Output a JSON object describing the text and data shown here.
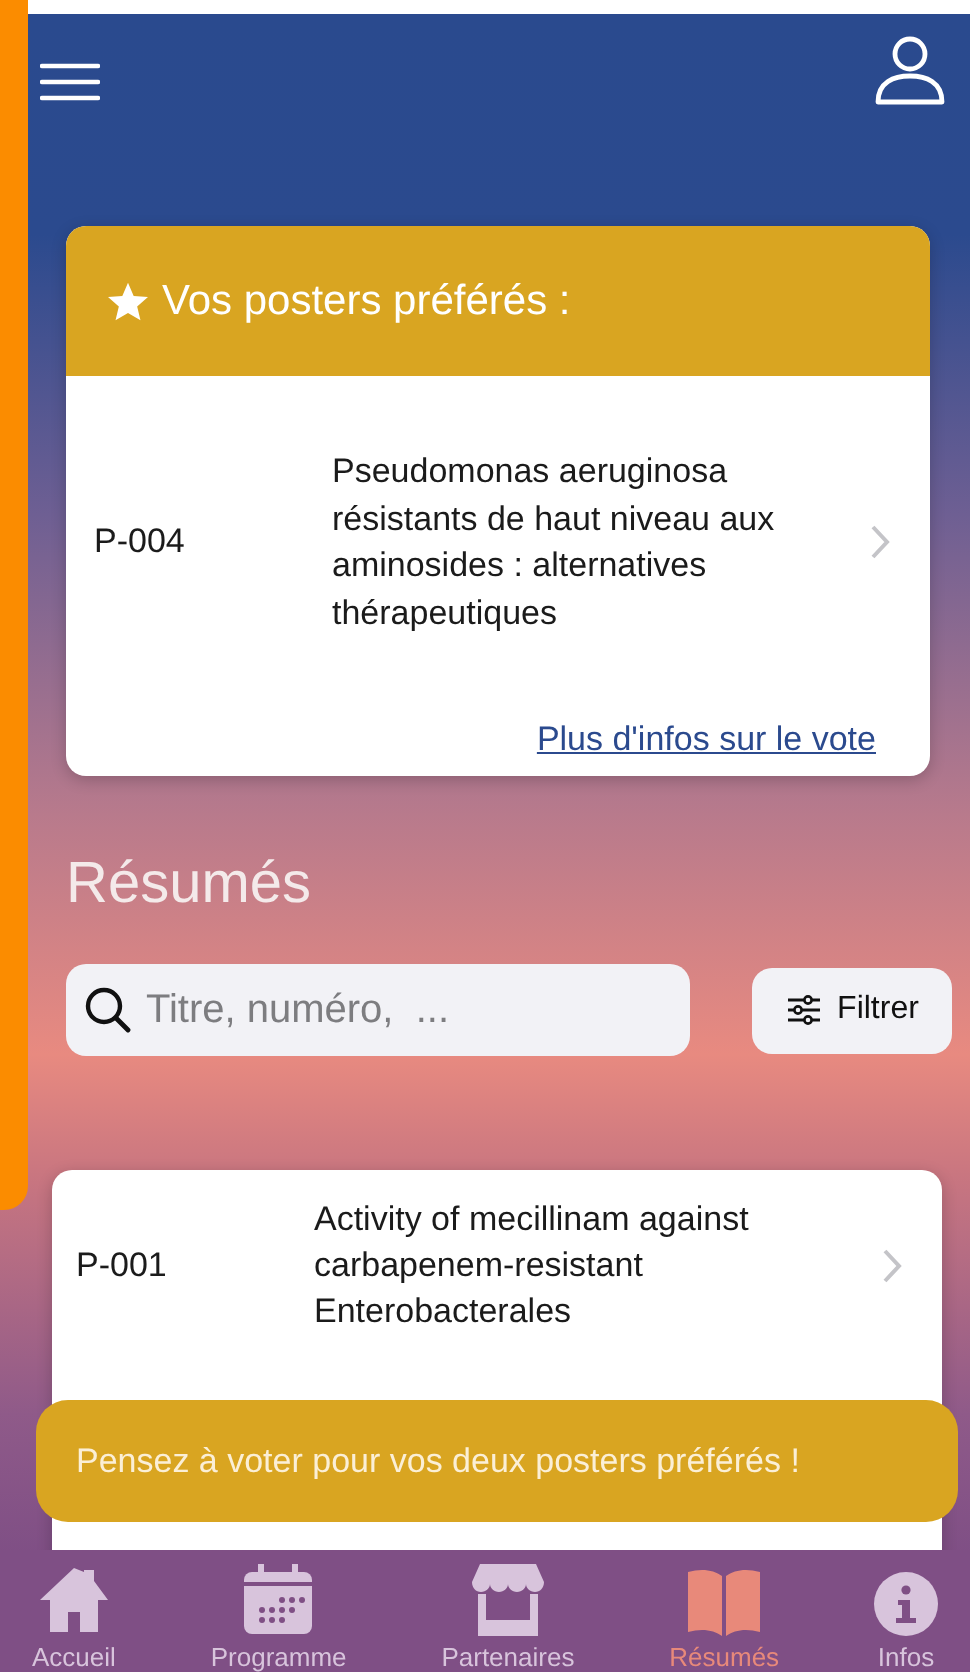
{
  "favorites": {
    "title": "Vos posters préférés :",
    "items": [
      {
        "number": "P-004",
        "title": "Pseudomonas aeruginosa résistants de haut niveau aux aminosides : alternatives thérapeutiques"
      }
    ],
    "link": "Plus d'infos sur le vote"
  },
  "section_title": "Résumés",
  "search": {
    "placeholder": "Titre, numéro,  ..."
  },
  "filter_button": "Filtrer",
  "abstracts": [
    {
      "number": "P-001",
      "title": "Activity of mecillinam against carbapenem-resistant Enterobacterales"
    }
  ],
  "toast": "Pensez à voter pour vos deux posters préférés !",
  "tabs": [
    {
      "kind": "home",
      "label": "Accueil",
      "selected": false
    },
    {
      "kind": "calendar",
      "label": "Programme",
      "selected": false
    },
    {
      "kind": "store",
      "label": "Partenaires",
      "selected": false
    },
    {
      "kind": "book",
      "label": "Résumés",
      "selected": true
    },
    {
      "kind": "info",
      "label": "Infos",
      "selected": false
    }
  ]
}
